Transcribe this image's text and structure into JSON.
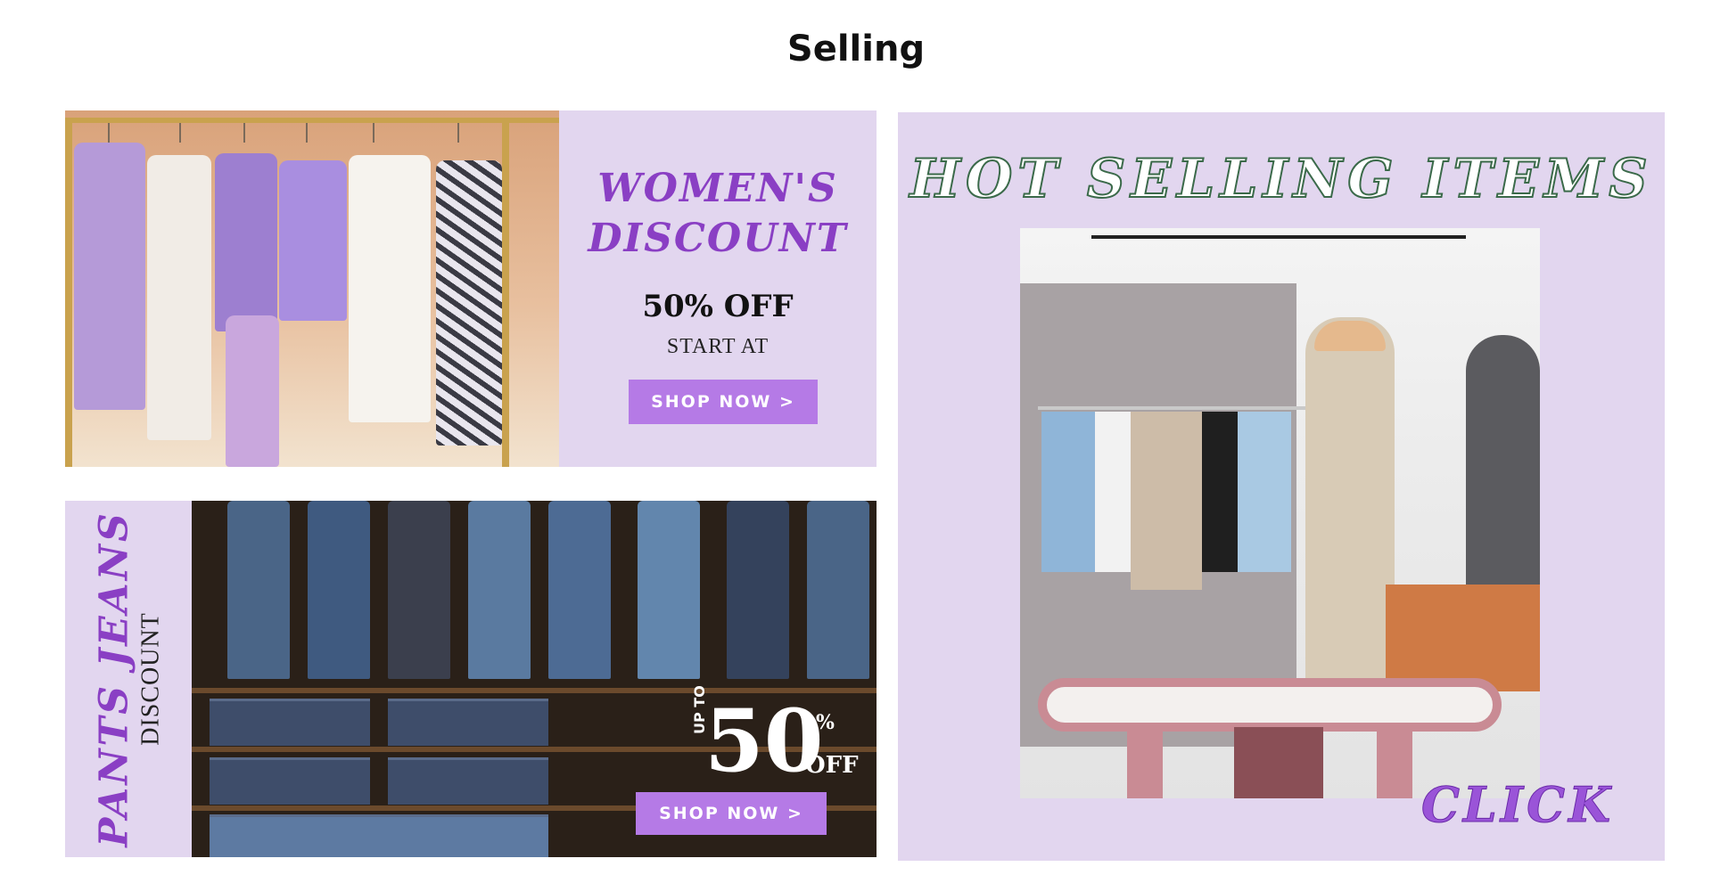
{
  "page": {
    "title": "Selling"
  },
  "women": {
    "heading_line1": "WOMEN'S",
    "heading_line2": "DISCOUNT",
    "offer": "50% OFF",
    "start": "START  AT",
    "button": "SHOP NOW >"
  },
  "jeans": {
    "heading": "PANTS JEANS",
    "sub": "DISCOUNT",
    "upto": "UP TO",
    "percent_value": "50",
    "percent_sign": "%",
    "off": "OFF",
    "button": "SHOP NOW >"
  },
  "hot": {
    "heading": "HOT SELLING ITEMS",
    "click": "CLICK"
  },
  "colors": {
    "card_bg": "#e2d6ef",
    "accent_purple": "#8a3fc4",
    "button_purple": "#b57ae6"
  }
}
